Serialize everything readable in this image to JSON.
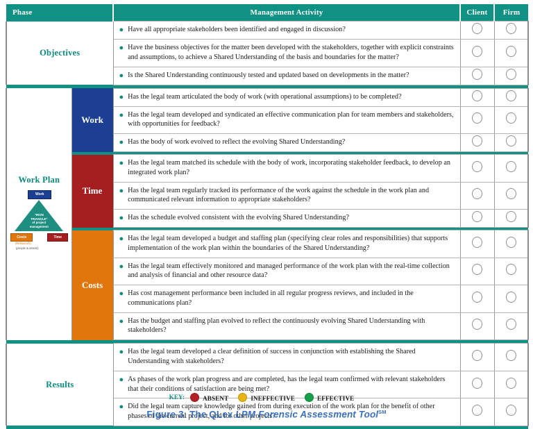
{
  "header": {
    "phase": "Phase",
    "activity": "Management Activity",
    "client": "Client",
    "firm": "Firm"
  },
  "phases": [
    {
      "name": "Objectives",
      "subphases": [
        {
          "name": "",
          "color": "",
          "activities": [
            "Have all appropriate stakeholders been identified and engaged in discussion?",
            "Have the business objectives for the matter been developed with the stakeholders, together with explicit constraints and assumptions, to achieve a Shared Understanding of the basis and boundaries for the matter?",
            "Is the Shared Understanding continuously tested and updated based on developments in the matter?"
          ]
        }
      ]
    },
    {
      "name": "Work Plan",
      "subphases": [
        {
          "name": "Work",
          "color": "#1c3f94",
          "activities": [
            "Has the legal team articulated the body of work (with operational assumptions) to be completed?",
            "Has the legal team developed and syndicated an effective communication plan for team members and stakeholders, with opportunities for feedback?",
            "Has the body of work evolved to reflect the evolving Shared Understanding?"
          ]
        },
        {
          "name": "Time",
          "color": "#a51f20",
          "activities": [
            "Has the legal team matched its schedule with the body of work, incorporating stakeholder feedback, to develop an integrated work plan?",
            "Has the legal team regularly tracked its performance of the work against the schedule in the work plan and communicated relevant information to appropriate stakeholders?",
            "Has the schedule evolved consistent with the evolving Shared Understanding?"
          ]
        },
        {
          "name": "Costs",
          "color": "#e0760c",
          "activities": [
            "Has the legal team developed a budget and staffing plan (specifying clear roles and responsibilities) that supports implementation of the work plan within the boundaries of the Shared Understanding?",
            "Has the legal team effectively monitored and managed performance of the work plan with the real-time collection and analysis of financial and other resource data?",
            "Has cost management performance been included in all regular progress reviews, and included in the communications plan?",
            "Has the budget and staffing plan evolved to reflect the continuously evolving Shared Understanding with stakeholders?"
          ]
        }
      ]
    },
    {
      "name": "Results",
      "subphases": [
        {
          "name": "",
          "color": "",
          "activities": [
            "Has the legal team developed a clear definition of success in conjunction with establishing the Shared Understanding with stakeholders?",
            "As phases of the work plan progress and are completed, has the legal team confirmed with relevant stakeholders that their conditions of satisfaction are being met?",
            "Did the legal team capture knowledge gained from during execution of the work plan for the benefit of other phases of the current project, and for other projects?"
          ]
        }
      ]
    }
  ],
  "triangle": {
    "top_label": "Work",
    "inner_line1": "\"IRON",
    "inner_line2": "TRIANGLE\"",
    "inner_line3": "of project",
    "inner_line4": "management",
    "left_label": "Costs",
    "right_label": "Time",
    "left_sub1": "(Resources)",
    "left_sub2": "(people & assets)"
  },
  "key": {
    "label": "KEY:",
    "items": [
      {
        "label": "ABSENT",
        "color": "#b52025"
      },
      {
        "label": "INEFFECTIVE",
        "color": "#e8b413"
      },
      {
        "label": "EFFECTIVE",
        "color": "#17a04a"
      }
    ]
  },
  "caption": {
    "prefix": "Figure 3: The QLex ",
    "italic": "LPM Forensic Assessment Tool",
    "superscript": "SM"
  },
  "colors": {
    "header_teal": "#119184",
    "phase_text": "#0f8b7e",
    "caption_blue": "#3b6fb6",
    "work_blue": "#1c3f94",
    "time_red": "#a51f20",
    "costs_orange": "#e0760c"
  }
}
